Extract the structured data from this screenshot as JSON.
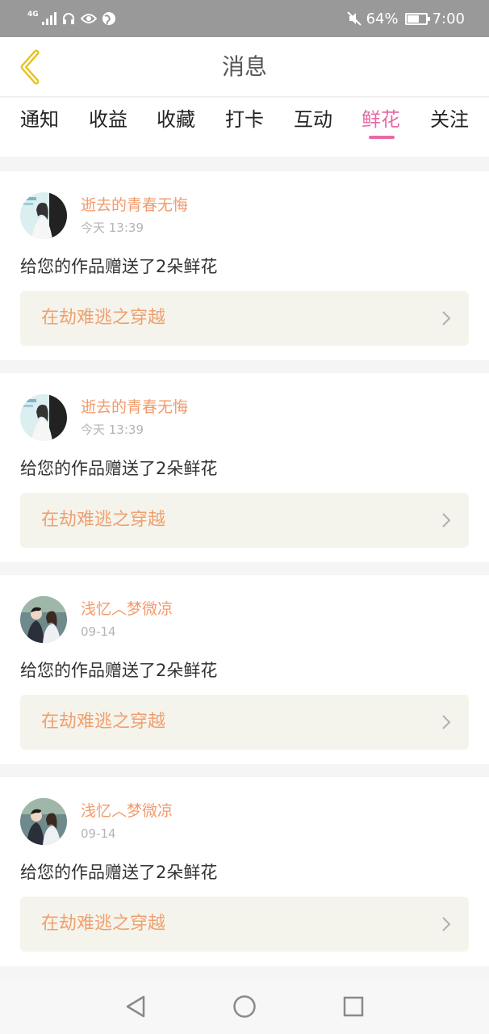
{
  "status_bar": {
    "network": "4G",
    "battery_percent": "64%",
    "battery_level": 0.64,
    "time": "7:00",
    "icons": [
      "signal-icon",
      "headset-icon",
      "eye-icon",
      "globe-icon",
      "mute-icon",
      "battery-icon"
    ]
  },
  "header": {
    "title": "消息",
    "back_icon": "chevron-left-icon"
  },
  "tabs": [
    {
      "label": "通知",
      "active": false
    },
    {
      "label": "收益",
      "active": false
    },
    {
      "label": "收藏",
      "active": false
    },
    {
      "label": "打卡",
      "active": false
    },
    {
      "label": "互动",
      "active": false
    },
    {
      "label": "鲜花",
      "active": true
    },
    {
      "label": "关注",
      "active": false
    }
  ],
  "messages": [
    {
      "user": "逝去的青春无悔",
      "time": "今天 13:39",
      "text": "给您的作品赠送了2朵鲜花",
      "book": "在劫难逃之穿越"
    },
    {
      "user": "逝去的青春无悔",
      "time": "今天 13:39",
      "text": "给您的作品赠送了2朵鲜花",
      "book": "在劫难逃之穿越"
    },
    {
      "user": "浅忆︿梦微凉",
      "time": "09-14",
      "text": "给您的作品赠送了2朵鲜花",
      "book": "在劫难逃之穿越"
    },
    {
      "user": "浅忆︿梦微凉",
      "time": "09-14",
      "text": "给您的作品赠送了2朵鲜花",
      "book": "在劫难逃之穿越"
    }
  ],
  "colors": {
    "accent": "#e76ba5",
    "username": "#f39a6b",
    "book_title": "#f0a070",
    "back_arrow": "#e8c21a",
    "status_bar": "#999999"
  }
}
